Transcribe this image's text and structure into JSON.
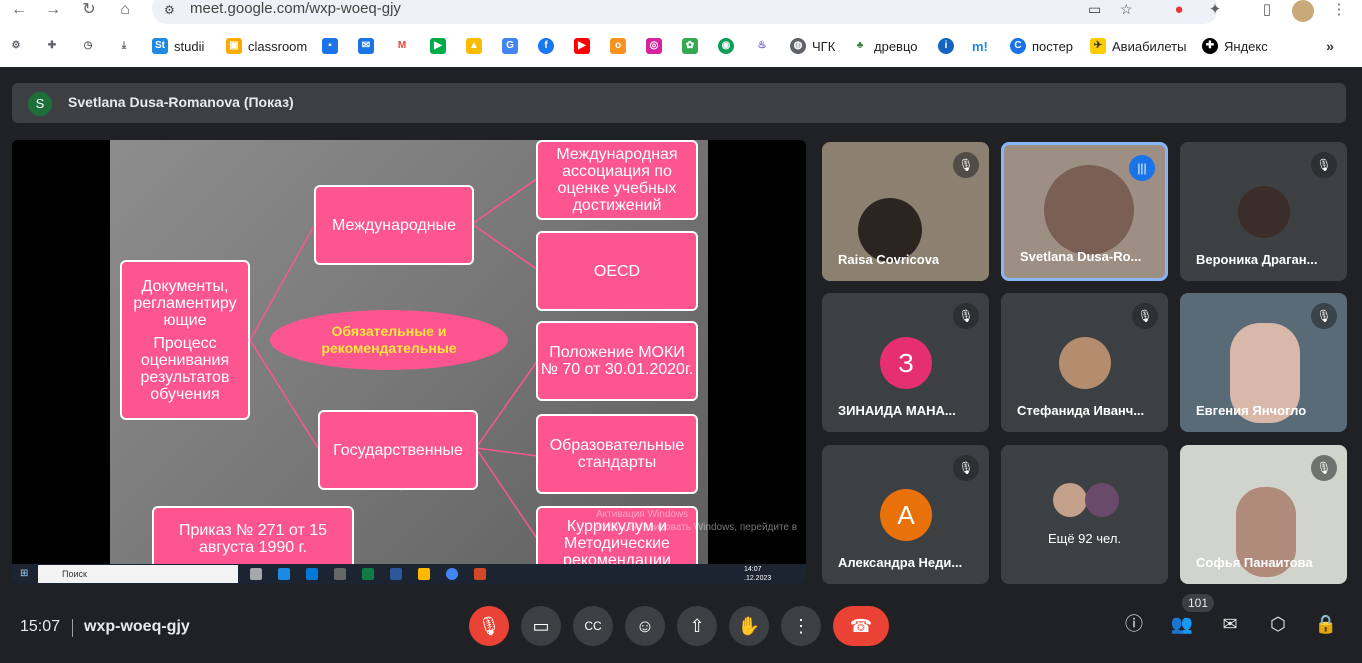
{
  "browser": {
    "url": "meet.google.com/wxp-woeq-gjy",
    "bookmarks": [
      "studii",
      "classroom",
      "ЧГК",
      "древцо",
      "m!",
      "постер",
      "Авиабилеты",
      "Яндекс"
    ]
  },
  "presentation_bar": {
    "avatar_letter": "S",
    "presenter": "Svetlana Dusa-Romanova (Показ)"
  },
  "slide": {
    "left_box": "Документы, регламентиру ющие",
    "left_box2": "Процесс оценивания результатов обучения",
    "oval": "Обязательные и рекомендательные",
    "intl": "Международные",
    "state": "Государственные",
    "r1": "Международная ассоциация по оценке учебных достижений",
    "r2": "OECD",
    "r3": "Положение МОКИ № 70 от 30.01.2020г.",
    "r4": "Образовательные стандарты",
    "r5": "Куррикулум и Методические рекомендации",
    "bottom": "Приказ № 271 от 15 августа 1990 г.",
    "watermark1": "Активация Windows",
    "watermark2": "Чтобы активировать Windows, перейдите в",
    "taskbar_search": "Поиск",
    "taskbar_time": "14:07",
    "taskbar_date": ".12.2023"
  },
  "participants": [
    {
      "name": "Raisa Covricova",
      "muted": true
    },
    {
      "name": "Svetlana Dusa-Ro...",
      "speaking": true
    },
    {
      "name": "Вероника Драган...",
      "muted": true
    },
    {
      "name": "ЗИНАИДА МАНА...",
      "avatar_letter": "З",
      "avatar_color": "#e52f6f",
      "muted": true
    },
    {
      "name": "Стефанида Иванч...",
      "muted": true
    },
    {
      "name": "Евгения Янчогло",
      "muted": true
    },
    {
      "name": "Александра Неди...",
      "avatar_letter": "А",
      "avatar_color": "#e8710a",
      "muted": true
    },
    {
      "name": "Ещё 92 чел."
    },
    {
      "name": "Софья Панаитова",
      "muted": true
    }
  ],
  "controls": {
    "time": "15:07",
    "meeting_code": "wxp-woeq-gjy",
    "participant_count": "101"
  },
  "colors": {
    "slide_pink": "#fd5590",
    "oval_text": "#ffe640",
    "end_call": "#ea4335",
    "speaking_border": "#8ab4f8"
  }
}
